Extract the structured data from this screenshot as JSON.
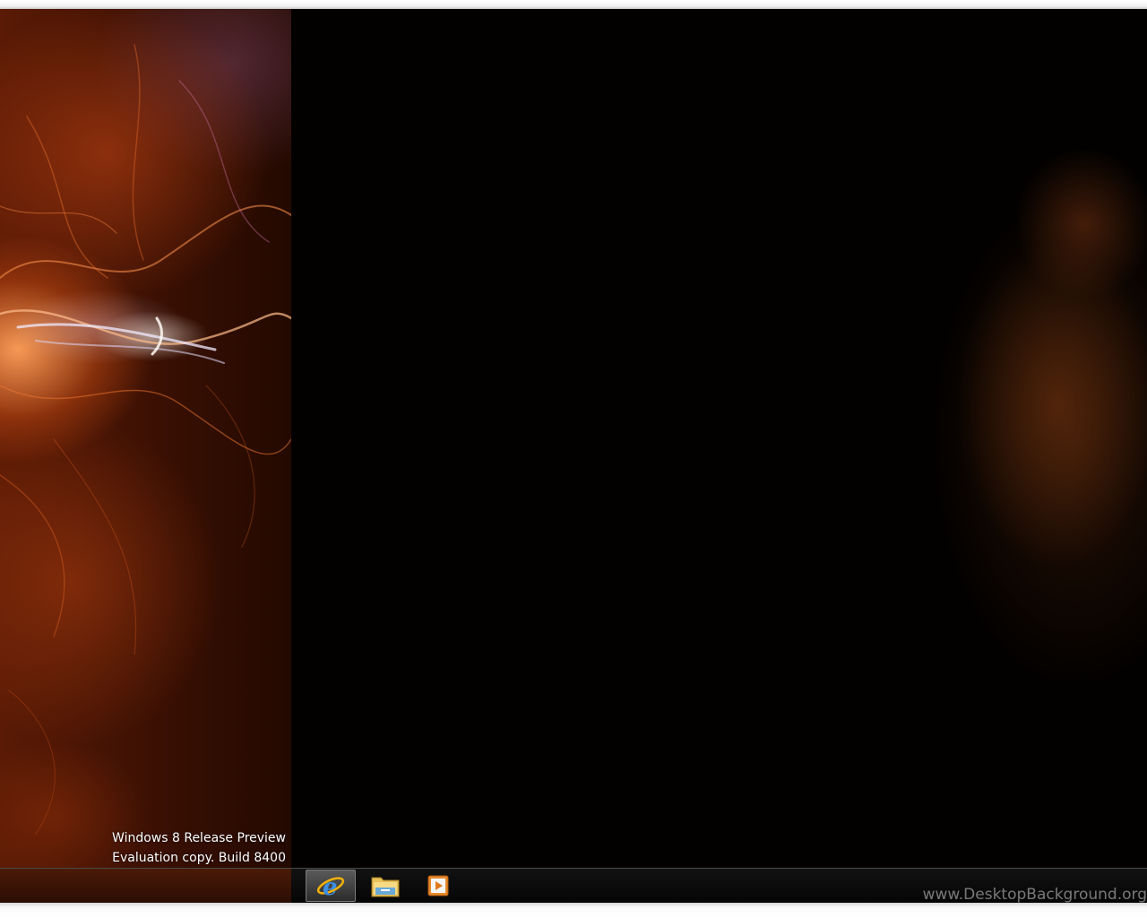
{
  "watermark": {
    "line1": "Windows 8 Release Preview",
    "line2": "Evaluation copy. Build 8400"
  },
  "taskbar": {
    "items": [
      {
        "name": "internet-explorer",
        "icon": "ie-icon",
        "active": true
      },
      {
        "name": "file-explorer",
        "icon": "folder-icon",
        "active": false
      },
      {
        "name": "media-player",
        "icon": "media-player-icon",
        "active": false
      }
    ]
  },
  "site_watermark": "www.DesktopBackground.org",
  "colors": {
    "accent_orange": "#e06a20",
    "taskbar_bg": "#0a0a0a",
    "desktop_bg": "#030100"
  }
}
